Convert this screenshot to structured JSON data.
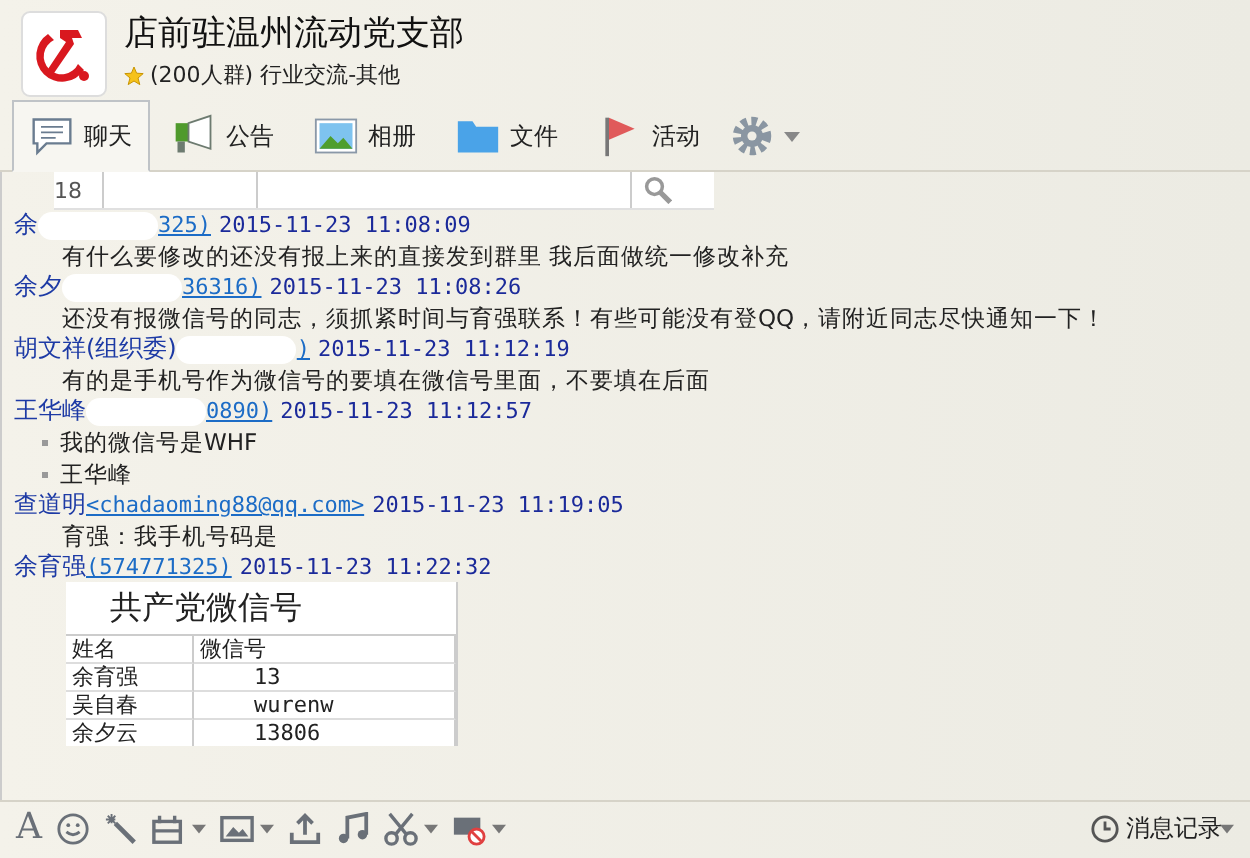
{
  "group": {
    "title": "店前驻温州流动党支部",
    "subtitle": "(200人群) 行业交流-其他"
  },
  "tabs": [
    {
      "label": "聊天",
      "selected": true,
      "kind": "chat"
    },
    {
      "label": "公告",
      "selected": false,
      "kind": "notice"
    },
    {
      "label": "相册",
      "selected": false,
      "kind": "album"
    },
    {
      "label": "文件",
      "selected": false,
      "kind": "file"
    },
    {
      "label": "活动",
      "selected": false,
      "kind": "event"
    }
  ],
  "top_image": {
    "row_number": "18"
  },
  "messages": [
    {
      "sender": "余",
      "masked": true,
      "contact": "325)",
      "time": "2015-11-23 11:08:09",
      "kind": "text",
      "lines": [
        "有什么要修改的还没有报上来的直接发到群里 我后面做统一修改补充"
      ]
    },
    {
      "sender": "余夕",
      "masked": true,
      "contact": "36316)",
      "time": "2015-11-23 11:08:26",
      "kind": "text",
      "lines": [
        "还没有报微信号的同志，须抓紧时间与育强联系！有些可能没有登QQ，请附近同志尽快通知一下！"
      ]
    },
    {
      "sender": "胡文祥(组织委)",
      "masked": true,
      "contact": ")",
      "time": "2015-11-23 11:12:19",
      "kind": "text",
      "lines": [
        "有的是手机号作为微信号的要填在微信号里面，不要填在后面"
      ]
    },
    {
      "sender": "王华峰",
      "masked": true,
      "contact": "0890)",
      "time": "2015-11-23 11:12:57",
      "kind": "bullets",
      "lines": [
        "我的微信号是WHF",
        "王华峰"
      ]
    },
    {
      "sender": "查道明",
      "masked": false,
      "contact": "<chadaoming88@qq.com>",
      "time": "2015-11-23 11:19:05",
      "kind": "text",
      "lines": [
        "育强：我手机号码是"
      ]
    },
    {
      "sender": "余育强",
      "masked": false,
      "contact": "(574771325)",
      "time": "2015-11-23 11:22:32",
      "kind": "image"
    }
  ],
  "sheet": {
    "title": "共产党微信号",
    "columns": [
      "姓名",
      "微信号"
    ],
    "rows": [
      [
        "余育强",
        "13"
      ],
      [
        "吴自春",
        "wurenw"
      ],
      [
        "余夕云",
        "13806"
      ]
    ]
  },
  "font_glyph": "A",
  "history_button": "消息记录"
}
